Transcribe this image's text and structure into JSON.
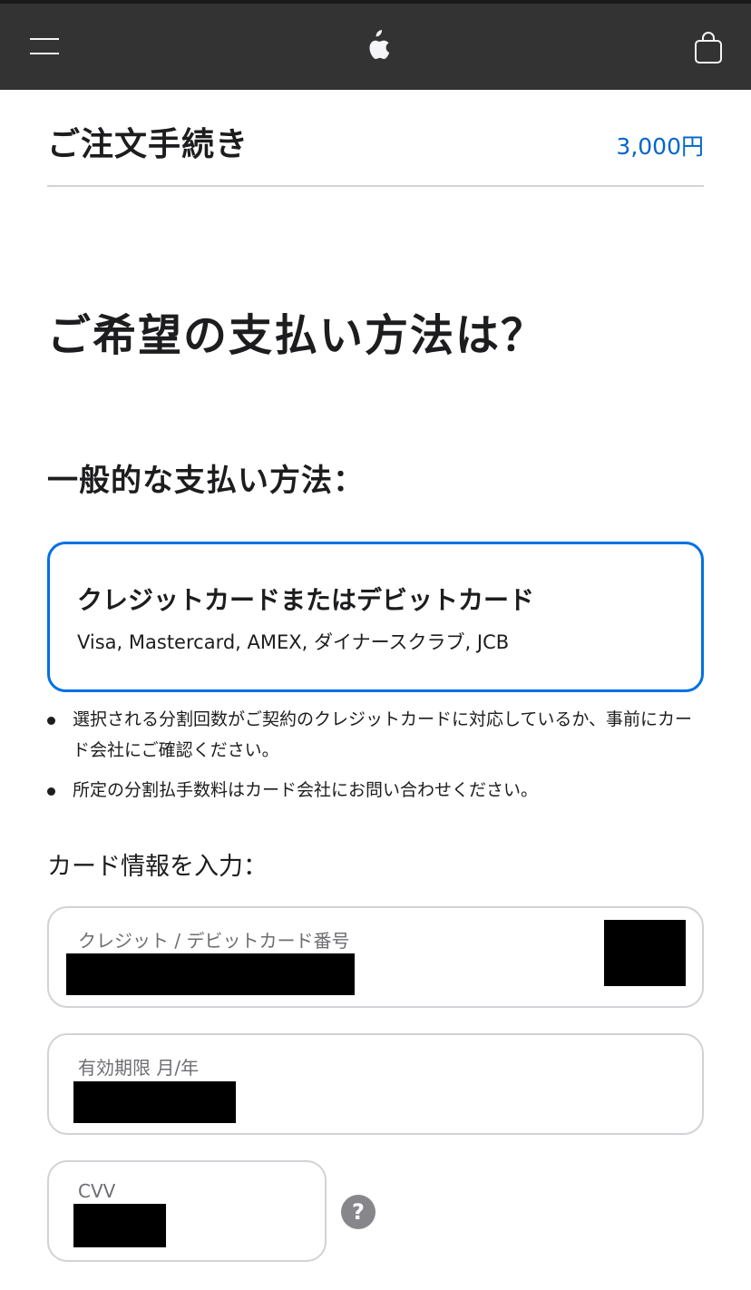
{
  "nav": {
    "menu_icon": "menu-icon",
    "logo_icon": "apple-logo-icon",
    "bag_icon": "shopping-bag-icon"
  },
  "header": {
    "title": "ご注文手続き",
    "total": "3,000円"
  },
  "main_heading": "ご希望の支払い方法は？",
  "section_heading": "一般的な支払い方法：",
  "payment_option": {
    "title": "クレジットカードまたはデビットカード",
    "subtitle": "Visa, Mastercard, AMEX, ダイナースクラブ, JCB",
    "selected": true
  },
  "notes": [
    "選択される分割回数がご契約のクレジットカードに対応しているか、事前にカード会社にご確認ください。",
    "所定の分割払手数料はカード会社にお問い合わせください。"
  ],
  "card_form": {
    "heading": "カード情報を入力：",
    "card_number_label": "クレジット / デビットカード番号",
    "expiry_label": "有効期限 月/年",
    "cvv_label": "CVV",
    "help_glyph": "?"
  },
  "colors": {
    "accent": "#0071e3",
    "link": "#0066cc",
    "nav_bg": "#333333"
  }
}
